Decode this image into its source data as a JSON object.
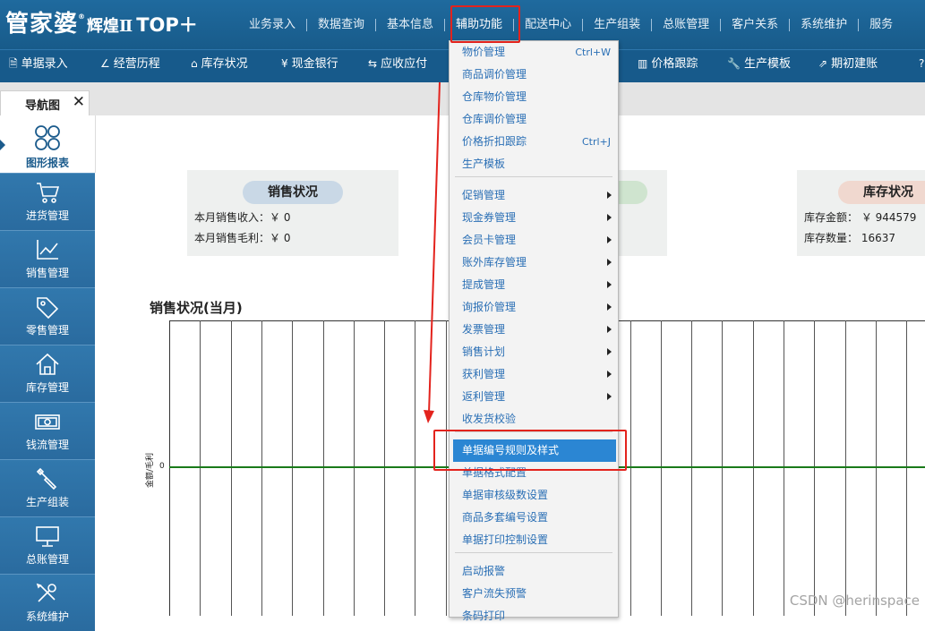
{
  "app": {
    "logo_main": "管家婆",
    "logo_sub": "辉煌Ⅱ",
    "logo_top": "TOP＋",
    "logo_reg": "®"
  },
  "topnav": [
    {
      "label": "业务录入"
    },
    {
      "label": "数据查询"
    },
    {
      "label": "基本信息"
    },
    {
      "label": "辅助功能"
    },
    {
      "label": "配送中心"
    },
    {
      "label": "生产组装"
    },
    {
      "label": "总账管理"
    },
    {
      "label": "客户关系"
    },
    {
      "label": "系统维护"
    },
    {
      "label": "服务"
    }
  ],
  "toolbar": [
    {
      "icon": "document-icon",
      "glyph": "🗎",
      "label": "单据录入"
    },
    {
      "icon": "chart-line-icon",
      "glyph": "∠",
      "label": "经营历程"
    },
    {
      "icon": "home-icon",
      "glyph": "⌂",
      "label": "库存状况"
    },
    {
      "icon": "yen-icon",
      "glyph": "¥",
      "label": "现金银行"
    },
    {
      "icon": "exchange-icon",
      "glyph": "⇆",
      "label": "应收应付"
    },
    {
      "icon": "bar-chart-icon",
      "glyph": "▥",
      "label": "价格跟踪"
    },
    {
      "icon": "wrench-icon",
      "glyph": "🔧",
      "label": "生产模板"
    },
    {
      "icon": "external-icon",
      "glyph": "⇗",
      "label": "期初建账"
    },
    {
      "icon": "help-icon",
      "glyph": "?",
      "label": ""
    }
  ],
  "tab": {
    "label": "导航图",
    "close": "✕"
  },
  "sidebar": {
    "first": {
      "label": "图形报表"
    },
    "items": [
      {
        "label": "进货管理",
        "icon": "cart-icon"
      },
      {
        "label": "销售管理",
        "icon": "trend-icon"
      },
      {
        "label": "零售管理",
        "icon": "tag-icon"
      },
      {
        "label": "库存管理",
        "icon": "house-icon"
      },
      {
        "label": "钱流管理",
        "icon": "money-icon"
      },
      {
        "label": "生产组装",
        "icon": "tools-icon"
      },
      {
        "label": "总账管理",
        "icon": "monitor-icon"
      },
      {
        "label": "系统维护",
        "icon": "settings-icon"
      }
    ]
  },
  "cards": {
    "sales": {
      "title": "销售状况",
      "row1": "本月销售收入：￥ 0",
      "row2": "本月销售毛利：￥ 0"
    },
    "stock": {
      "title": "库存状况",
      "row1": "库存金额： ￥ 944579",
      "row2": "库存数量： 16637"
    }
  },
  "chart_title": "销售状况(当月)",
  "chart_data": {
    "type": "line",
    "ylabel": "金额/毛利",
    "y_ticks": [
      "0"
    ],
    "categories_count": 25,
    "series": [
      {
        "values_all_zero": true,
        "color": "#1a7a1a"
      }
    ]
  },
  "dropdown": {
    "items": [
      {
        "label": "物价管理",
        "shortcut": "Ctrl+W"
      },
      {
        "label": "商品调价管理"
      },
      {
        "label": "仓库物价管理"
      },
      {
        "label": "仓库调价管理"
      },
      {
        "label": "价格折扣跟踪",
        "shortcut": "Ctrl+J"
      },
      {
        "label": "生产模板"
      },
      {
        "label": "促销管理",
        "sub": true
      },
      {
        "label": "现金券管理",
        "sub": true
      },
      {
        "label": "会员卡管理",
        "sub": true
      },
      {
        "label": "账外库存管理",
        "sub": true
      },
      {
        "label": "提成管理",
        "sub": true
      },
      {
        "label": "询报价管理",
        "sub": true
      },
      {
        "label": "发票管理",
        "sub": true
      },
      {
        "label": "销售计划",
        "sub": true
      },
      {
        "label": "获利管理",
        "sub": true
      },
      {
        "label": "返利管理",
        "sub": true
      },
      {
        "label": "收发货校验"
      },
      {
        "label": "单据编号规则及样式",
        "highlighted": true
      },
      {
        "label": "单据格式配置"
      },
      {
        "label": "单据审核级数设置"
      },
      {
        "label": "商品多套编号设置"
      },
      {
        "label": "单据打印控制设置"
      },
      {
        "label": "启动报警"
      },
      {
        "label": "客户流失预警"
      },
      {
        "label": "条码打印"
      }
    ]
  },
  "watermark": "CSDN @herinspace",
  "colors": {
    "header": "#1f6a9e",
    "highlight": "#2b86d3",
    "annotation": "#e3231d",
    "series": "#1a7a1a"
  }
}
